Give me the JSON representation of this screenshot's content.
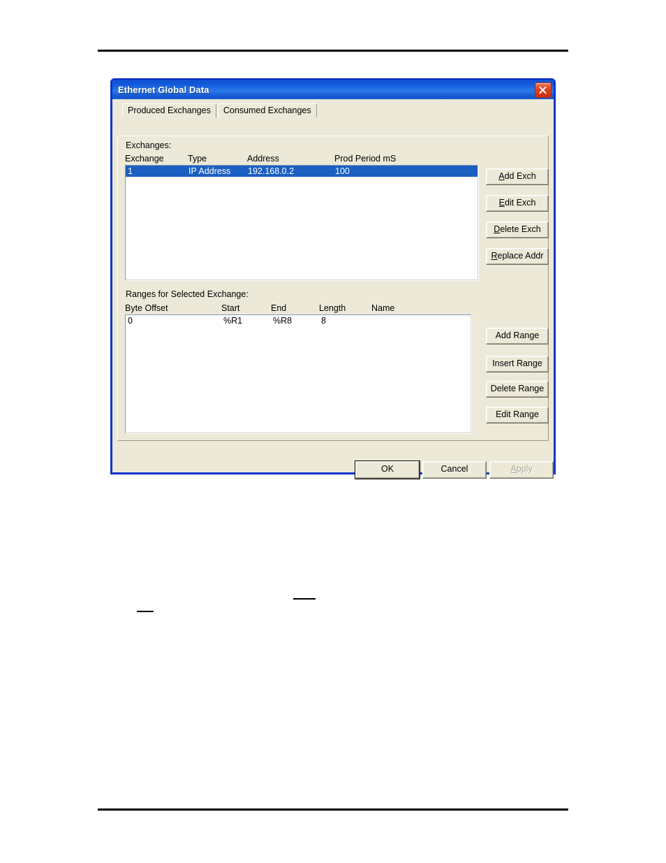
{
  "dialog": {
    "title": "Ethernet Global Data",
    "close_icon": "close-icon"
  },
  "tabs": [
    {
      "label": "Produced Exchanges",
      "selected": true
    },
    {
      "label": "Consumed Exchanges",
      "selected": false
    }
  ],
  "exchanges_group": {
    "label": "Exchanges:",
    "columns": [
      "Exchange",
      "Type",
      "Address",
      "Prod Period mS"
    ],
    "rows": [
      {
        "exchange": "1",
        "type": "IP Address",
        "address": "192.168.0.2",
        "prod_period": "100",
        "selected": true
      }
    ],
    "buttons": [
      {
        "accel": "A",
        "rest": "dd Exch"
      },
      {
        "accel": "E",
        "rest": "dit Exch"
      },
      {
        "accel": "D",
        "rest": "elete Exch"
      },
      {
        "accel": "R",
        "rest": "eplace Addr"
      }
    ]
  },
  "ranges_group": {
    "label": "Ranges for Selected Exchange:",
    "columns": [
      "Byte Offset",
      "Start",
      "End",
      "Length",
      "Name"
    ],
    "rows": [
      {
        "byte_offset": "0",
        "start": "%R1",
        "end": "%R8",
        "length": "8",
        "name": ""
      }
    ],
    "buttons": [
      {
        "label": "Add Range"
      },
      {
        "label": "Insert Range"
      },
      {
        "label": "Delete Range"
      },
      {
        "label": "Edit Range"
      }
    ]
  },
  "footer_buttons": {
    "ok": "OK",
    "cancel": "Cancel",
    "apply_accel": "A",
    "apply_rest": "pply"
  },
  "colors": {
    "titlebar_blue": "#0d51d4",
    "frame_blue": "#0b35c8",
    "selection_blue": "#1b5fc1",
    "face": "#ece9d8",
    "close_red": "#c62c10"
  }
}
